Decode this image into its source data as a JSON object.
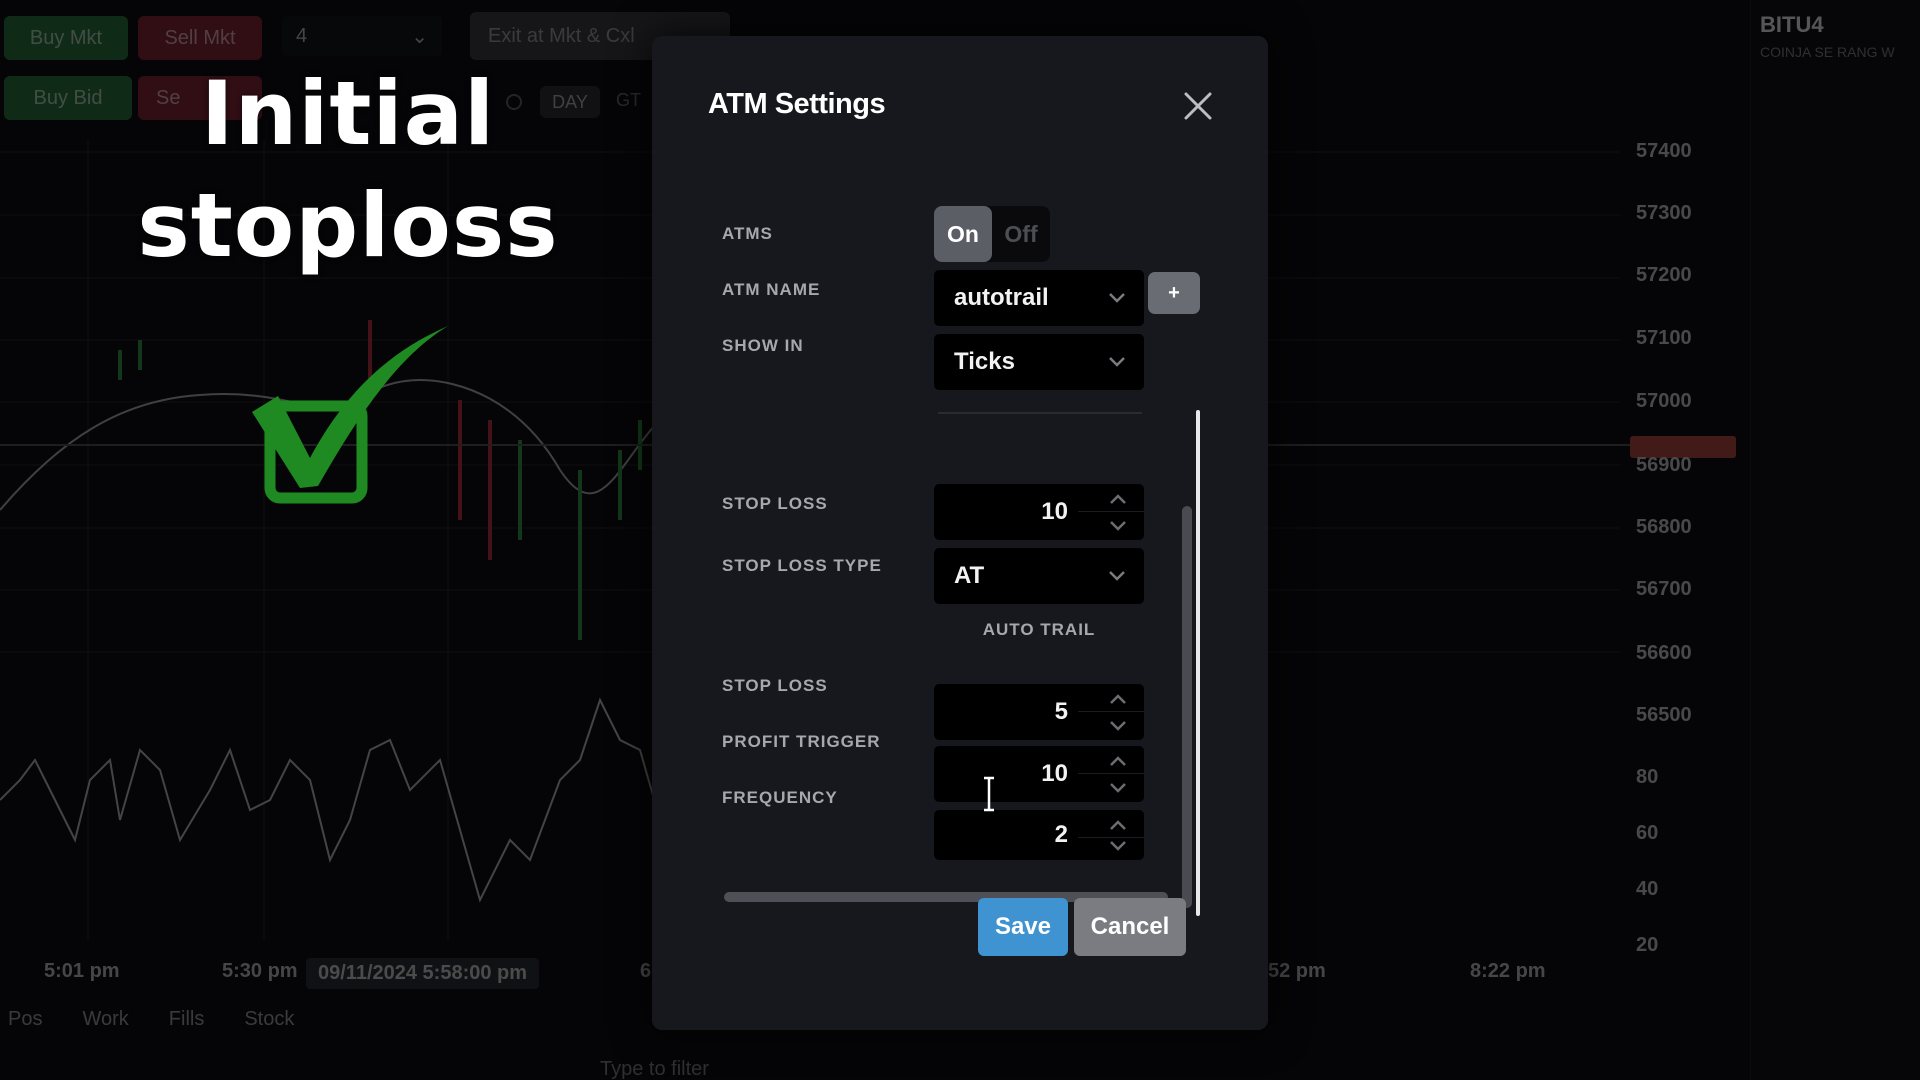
{
  "background_app": {
    "toolbar": {
      "buy_mkt": "Buy Mkt",
      "sell_mkt": "Sell Mkt",
      "buy_bid": "Buy Bid",
      "sell_ask": "Se",
      "quantity": "4",
      "exit_button": "Exit at Mkt & Cxl",
      "tif_day": "DAY",
      "tif_gtc": "GT"
    },
    "symbol": "BITU4",
    "symbol_sub": "COINJA SE RANG W",
    "price_axis": [
      "57400",
      "57300",
      "57200",
      "57100",
      "57000",
      "56900",
      "56800",
      "56700",
      "56600",
      "56500"
    ],
    "oscillator_axis": [
      "80",
      "60",
      "40",
      "20"
    ],
    "time_axis": [
      "5:01 pm",
      "5:30 pm",
      "6",
      "52 pm",
      "8:22 pm"
    ],
    "crosshair_time": "09/11/2024 5:58:00 pm",
    "bottom_tabs": [
      "Pos",
      "Work",
      "Fills",
      "Stock"
    ],
    "filter_placeholder": "Type to filter"
  },
  "overlay": {
    "caption_line1": "Initial",
    "caption_line2": "stoploss",
    "check_color": "#1f8a22"
  },
  "modal": {
    "title": "ATM Settings",
    "fields": {
      "atms": {
        "label": "ATMS",
        "options": [
          "On",
          "Off"
        ],
        "selected": "On"
      },
      "atm_name": {
        "label": "ATM NAME",
        "value": "autotrail",
        "add_label": "+"
      },
      "show_in": {
        "label": "SHOW IN",
        "value": "Ticks"
      },
      "stop_loss": {
        "label": "STOP LOSS",
        "value": "10"
      },
      "stop_loss_type": {
        "label": "STOP LOSS TYPE",
        "value": "AT"
      }
    },
    "auto_trail": {
      "heading": "AUTO TRAIL",
      "stop_loss": {
        "label": "STOP LOSS",
        "value": "5"
      },
      "profit_trigger": {
        "label": "PROFIT TRIGGER",
        "value": "10"
      },
      "frequency": {
        "label": "FREQUENCY",
        "value": "2"
      }
    },
    "buttons": {
      "save": "Save",
      "cancel": "Cancel"
    },
    "colors": {
      "save": "#3e93d0",
      "cancel": "#7b7c82",
      "panel": "#17181d"
    }
  }
}
